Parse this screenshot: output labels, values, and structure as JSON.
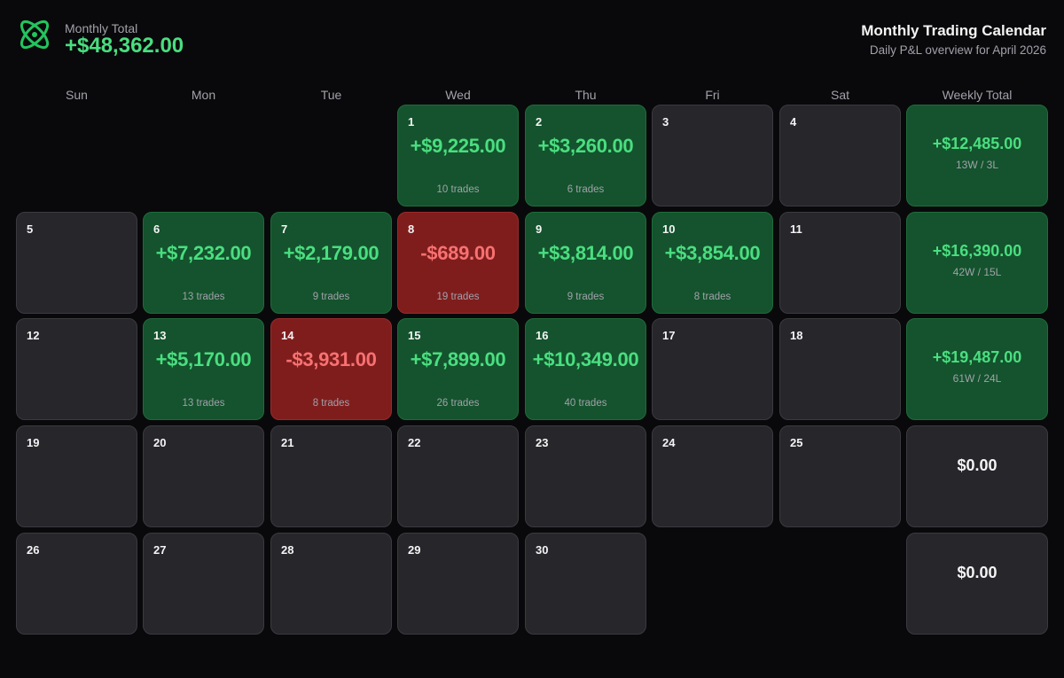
{
  "header": {
    "monthly_total_label": "Monthly Total",
    "monthly_total_value": "+$48,362.00",
    "title": "Monthly Trading Calendar",
    "subtitle": "Daily P&L overview for April 2026",
    "logo_icon": "atom-logo-icon"
  },
  "colors": {
    "background": "#09090b",
    "positive": "#4ade80",
    "positive_bg": "#14532d",
    "negative": "#f87171",
    "negative_bg": "#7f1d1d",
    "neutral_bg": "#26262b"
  },
  "weekdays": [
    "Sun",
    "Mon",
    "Tue",
    "Wed",
    "Thu",
    "Fri",
    "Sat",
    "Weekly Total"
  ],
  "weeks": [
    {
      "days": [
        null,
        null,
        null,
        {
          "day": "1",
          "pnl": "+$9,225.00",
          "trades": "10 trades",
          "status": "pos"
        },
        {
          "day": "2",
          "pnl": "+$3,260.00",
          "trades": "6 trades",
          "status": "pos"
        },
        {
          "day": "3",
          "pnl": "",
          "trades": "",
          "status": "none"
        },
        {
          "day": "4",
          "pnl": "",
          "trades": "",
          "status": "none"
        }
      ],
      "total": {
        "pnl": "+$12,485.00",
        "record": "13W / 3L",
        "status": "pos"
      }
    },
    {
      "days": [
        {
          "day": "5",
          "pnl": "",
          "trades": "",
          "status": "none"
        },
        {
          "day": "6",
          "pnl": "+$7,232.00",
          "trades": "13 trades",
          "status": "pos"
        },
        {
          "day": "7",
          "pnl": "+$2,179.00",
          "trades": "9 trades",
          "status": "pos"
        },
        {
          "day": "8",
          "pnl": "-$689.00",
          "trades": "19 trades",
          "status": "neg"
        },
        {
          "day": "9",
          "pnl": "+$3,814.00",
          "trades": "9 trades",
          "status": "pos"
        },
        {
          "day": "10",
          "pnl": "+$3,854.00",
          "trades": "8 trades",
          "status": "pos"
        },
        {
          "day": "11",
          "pnl": "",
          "trades": "",
          "status": "none"
        }
      ],
      "total": {
        "pnl": "+$16,390.00",
        "record": "42W / 15L",
        "status": "pos"
      }
    },
    {
      "days": [
        {
          "day": "12",
          "pnl": "",
          "trades": "",
          "status": "none"
        },
        {
          "day": "13",
          "pnl": "+$5,170.00",
          "trades": "13 trades",
          "status": "pos"
        },
        {
          "day": "14",
          "pnl": "-$3,931.00",
          "trades": "8 trades",
          "status": "neg"
        },
        {
          "day": "15",
          "pnl": "+$7,899.00",
          "trades": "26 trades",
          "status": "pos"
        },
        {
          "day": "16",
          "pnl": "+$10,349.00",
          "trades": "40 trades",
          "status": "pos"
        },
        {
          "day": "17",
          "pnl": "",
          "trades": "",
          "status": "none"
        },
        {
          "day": "18",
          "pnl": "",
          "trades": "",
          "status": "none"
        }
      ],
      "total": {
        "pnl": "+$19,487.00",
        "record": "61W / 24L",
        "status": "pos"
      }
    },
    {
      "days": [
        {
          "day": "19",
          "pnl": "",
          "trades": "",
          "status": "none"
        },
        {
          "day": "20",
          "pnl": "",
          "trades": "",
          "status": "none"
        },
        {
          "day": "21",
          "pnl": "",
          "trades": "",
          "status": "none"
        },
        {
          "day": "22",
          "pnl": "",
          "trades": "",
          "status": "none"
        },
        {
          "day": "23",
          "pnl": "",
          "trades": "",
          "status": "none"
        },
        {
          "day": "24",
          "pnl": "",
          "trades": "",
          "status": "none"
        },
        {
          "day": "25",
          "pnl": "",
          "trades": "",
          "status": "none"
        }
      ],
      "total": {
        "pnl": "$0.00",
        "record": "",
        "status": "zero"
      }
    },
    {
      "days": [
        {
          "day": "26",
          "pnl": "",
          "trades": "",
          "status": "none"
        },
        {
          "day": "27",
          "pnl": "",
          "trades": "",
          "status": "none"
        },
        {
          "day": "28",
          "pnl": "",
          "trades": "",
          "status": "none"
        },
        {
          "day": "29",
          "pnl": "",
          "trades": "",
          "status": "none"
        },
        {
          "day": "30",
          "pnl": "",
          "trades": "",
          "status": "none"
        },
        null,
        null
      ],
      "total": {
        "pnl": "$0.00",
        "record": "",
        "status": "zero"
      }
    }
  ]
}
